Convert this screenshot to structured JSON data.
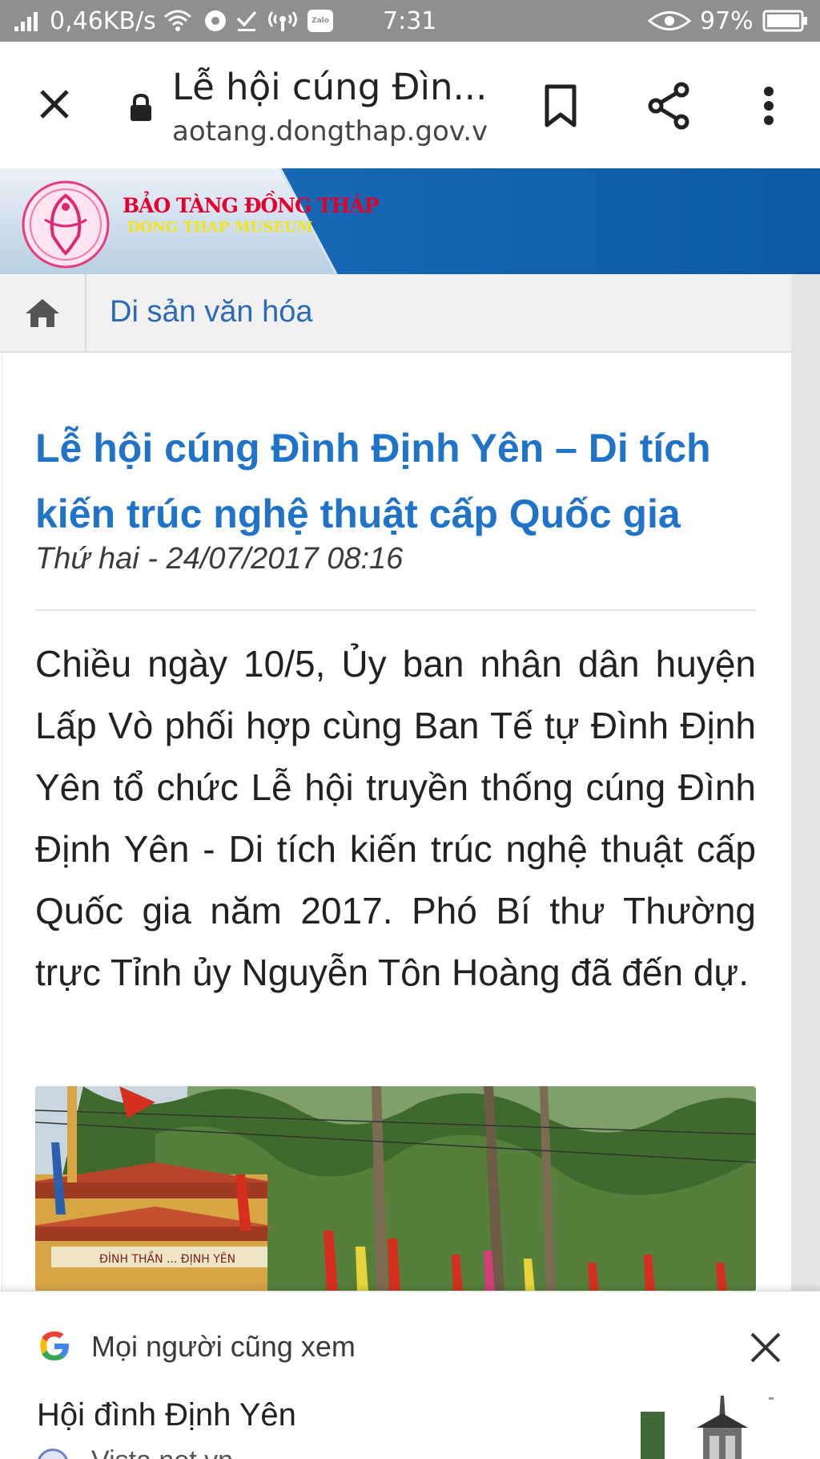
{
  "status_bar": {
    "net_speed": "0,46KB/s",
    "time": "7:31",
    "battery": "97%",
    "zalo_label": "Zalo",
    "icons": [
      "signal-icon",
      "wifi-icon",
      "chrome-icon",
      "download-done-icon",
      "hotspot-icon",
      "zalo-icon",
      "eye-icon",
      "battery-icon"
    ]
  },
  "browser": {
    "page_title": "Lễ hội cúng Đìn...",
    "url": "aotang.dongthap.gov.vn",
    "icons": [
      "close-icon",
      "lock-icon",
      "bookmark-icon",
      "share-icon",
      "more-vert-icon"
    ]
  },
  "site_header": {
    "logo_line1": "BẢO TÀNG ĐỒNG THÁP",
    "logo_line2": "DONG THAP MUSEUM",
    "colors": {
      "header_blue": "#1565b0",
      "logo_pink": "#e4002b",
      "logo_yellow": "#f4e21a"
    }
  },
  "breadcrumb": {
    "label": "Di sản văn hóa"
  },
  "article": {
    "title": "Lễ hội cúng Đình Định Yên – Di tích kiến trúc nghệ thuật cấp Quốc gia",
    "date": "Thứ hai - 24/07/2017 08:16",
    "body": "Chiều ngày 10/5, Ủy ban nhân dân huyện Lấp Vò phối hợp cùng Ban Tế tự Đình Định Yên tổ chức Lễ hội truyền thống cúng Đình Định Yên - Di tích kiến trúc nghệ thuật cấp Quốc gia năm 2017. Phó Bí thư Thường trực Tỉnh ủy Nguyễn Tôn Hoàng đã đến dự.",
    "photo_sign": "ĐÌNH THẦN ... ĐỊNH YÊN",
    "colors": {
      "title_blue": "#1f73c9"
    }
  },
  "suggestions": {
    "heading": "Mọi người cũng xem",
    "item_title": "Hội đình Định Yên",
    "item_source": "Vista.net.vn"
  }
}
